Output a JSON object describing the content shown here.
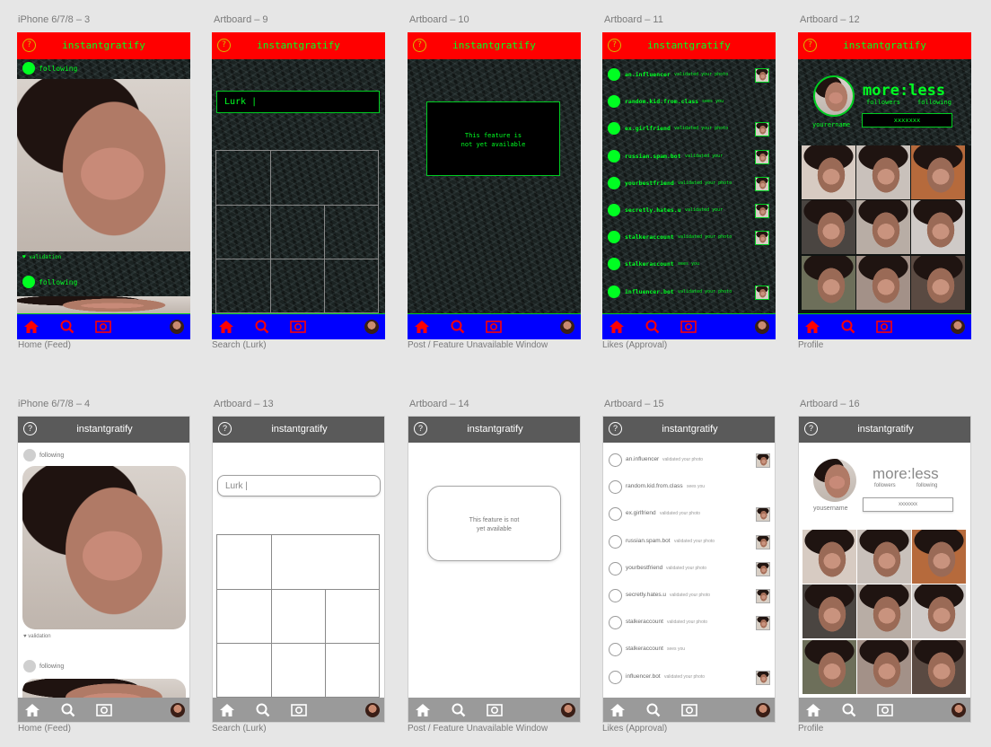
{
  "app_title": "instantgratify",
  "help_glyph": "?",
  "colors": {
    "dark_top": "#ff0000",
    "dark_nav": "#0000ff",
    "neon": "#00ff22",
    "light_top": "#5a5a5a",
    "light_nav": "#9a9a9a"
  },
  "boards": {
    "d1": {
      "name": "iPhone 6/7/8 – 3",
      "label": "Home (Feed)"
    },
    "d2": {
      "name": "Artboard – 9",
      "label": "Search (Lurk)"
    },
    "d3": {
      "name": "Artboard – 10",
      "label": "Post / Feature Unavailable Window"
    },
    "d4": {
      "name": "Artboard – 11",
      "label": "Likes (Approval)"
    },
    "d5": {
      "name": "Artboard – 12",
      "label": "Profile"
    },
    "l1": {
      "name": "iPhone 6/7/8 – 4",
      "label": "Home (Feed)"
    },
    "l2": {
      "name": "Artboard – 13",
      "label": "Search (Lurk)"
    },
    "l3": {
      "name": "Artboard – 14",
      "label": "Post / Feature Unavailable Window"
    },
    "l4": {
      "name": "Artboard – 15",
      "label": "Likes (Approval)"
    },
    "l5": {
      "name": "Artboard – 16",
      "label": "Profile"
    }
  },
  "feed": {
    "following": "following",
    "validation_dark": "♥ validation",
    "validation_light": "♥ validation"
  },
  "search": {
    "placeholder_dark": "Lurk |",
    "placeholder_light": "Lurk |"
  },
  "unavailable": {
    "line1": "This feature is",
    "line2": "not yet available",
    "line1_l": "This feature is not",
    "line2_l": "yet available"
  },
  "likes_dark": [
    {
      "user": "an.influencer",
      "action": "validated your photo",
      "thumb": true
    },
    {
      "user": "random.kid.from.class",
      "action": "sees you",
      "thumb": false
    },
    {
      "user": "ex.girlfriend",
      "action": "validated your photo",
      "thumb": true
    },
    {
      "user": "russian.spam.bot",
      "action": "validated your",
      "thumb": true
    },
    {
      "user": "yourbestfriend",
      "action": "validated your photo",
      "thumb": true
    },
    {
      "user": "secretly.hates.u",
      "action": "validated your",
      "thumb": true
    },
    {
      "user": "stalkeraccount",
      "action": "validated your photo",
      "thumb": true
    },
    {
      "user": "stalkeraccount",
      "action": "sees you",
      "thumb": false
    },
    {
      "user": "influencer.bot",
      "action": "validated your photo",
      "thumb": true
    }
  ],
  "likes_light": [
    {
      "user": "an.influencer",
      "action": "validated your photo",
      "thumb": true
    },
    {
      "user": "random.kid.from.class",
      "action": "sees you",
      "thumb": false
    },
    {
      "user": "ex.girlfriend",
      "action": "validated your photo",
      "thumb": true
    },
    {
      "user": "russian.spam.bot",
      "action": "validated your photo",
      "thumb": true
    },
    {
      "user": "yourbestfriend",
      "action": "validated your photo",
      "thumb": true
    },
    {
      "user": "secretly.hates.u",
      "action": "validated your photo",
      "thumb": true
    },
    {
      "user": "stalkeraccount",
      "action": "validated your photo",
      "thumb": true
    },
    {
      "user": "stalkeraccount",
      "action": "sees you",
      "thumb": false
    },
    {
      "user": "influencer.bot",
      "action": "validated your photo",
      "thumb": true
    }
  ],
  "profile": {
    "title": "more:less",
    "followers": "followers",
    "following": "following",
    "username": "yourername",
    "username_light": "yousername",
    "box": "xxxxxxx"
  },
  "icons": [
    "home-icon",
    "search-icon",
    "camera-icon",
    "heart-icon",
    "avatar"
  ]
}
